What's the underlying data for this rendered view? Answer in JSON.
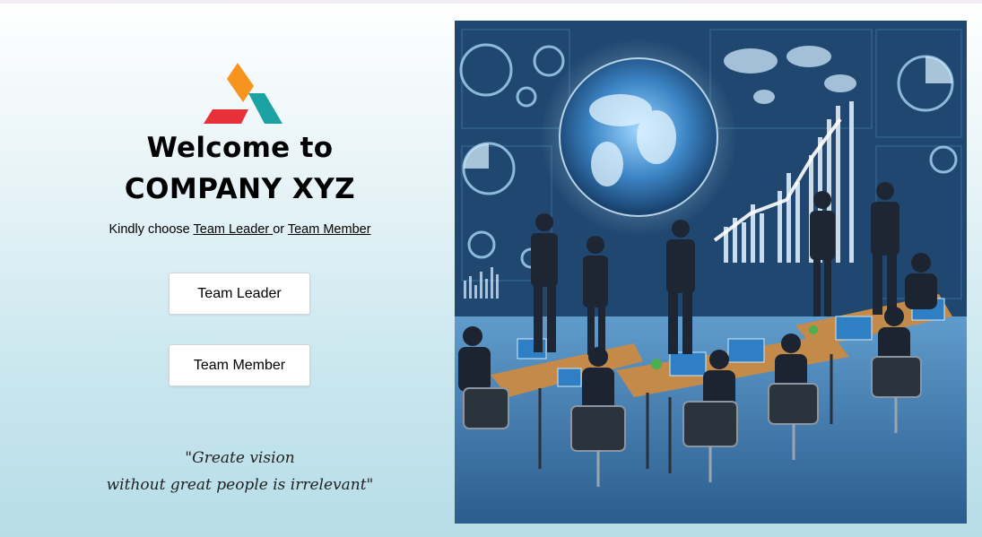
{
  "welcome": {
    "line1": "Welcome to",
    "line2": "COMPANY XYZ",
    "choose_prefix": "Kindly choose ",
    "team_leader_link": "Team Leader ",
    "choose_or": "or ",
    "team_member_link": "Team Member"
  },
  "buttons": {
    "team_leader": "Team Leader",
    "team_member": "Team Member"
  },
  "quote": {
    "line1": "\"Greate vision",
    "line2": "without great people is irrelevant\""
  },
  "logo": {
    "icon": "company-logo",
    "colors": [
      "#f7941d",
      "#e8303a",
      "#1ba3a3"
    ]
  },
  "hero": {
    "icon": "team-meeting-illustration"
  }
}
